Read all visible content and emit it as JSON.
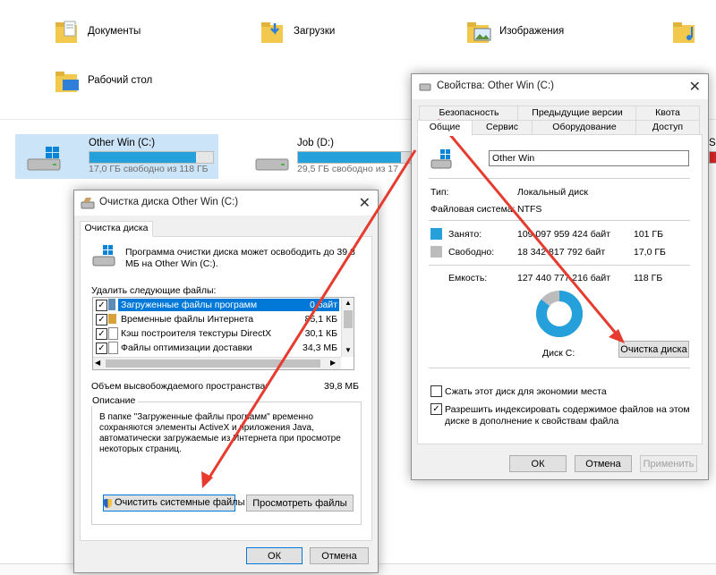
{
  "explorer": {
    "folders": [
      {
        "label": "Документы"
      },
      {
        "label": "Загрузки"
      },
      {
        "label": "Изображения"
      },
      {
        "label": "Рабочий стол"
      }
    ],
    "drives": [
      {
        "name": "Other Win (C:)",
        "free_text": "17,0 ГБ свободно из 118 ГБ",
        "used_fraction": 0.86
      },
      {
        "name": "Job (D:)",
        "free_text": "29,5 ГБ свободно из 17",
        "used_fraction": 0.9
      },
      {
        "name": "SS",
        "used_fraction": 0.95
      }
    ]
  },
  "cleanup_dialog": {
    "title": "Очистка диска Other Win (C:)",
    "close_glyph": "✕",
    "tab_label": "Очистка диска",
    "intro": [
      "Программа очистки диска может освободить до 39,8",
      "МБ на Other Win (C:)."
    ],
    "delete_label": "Удалить следующие файлы:",
    "files": [
      {
        "name": "Загруженные файлы программ",
        "size": "0 байт",
        "checked": true
      },
      {
        "name": "Временные файлы Интернета",
        "size": "85,1 КБ",
        "checked": true
      },
      {
        "name": "Кэш построителя текстуры DirectX",
        "size": "30,1 КБ",
        "checked": true
      },
      {
        "name": "Файлы оптимизации доставки",
        "size": "34,3 МБ",
        "checked": true
      }
    ],
    "space_label": "Объем высвобождаемого пространства:",
    "space_value": "39,8 МБ",
    "description_label": "Описание",
    "description": [
      "В папке \"Загруженные файлы программ\" временно",
      "сохраняются элементы ActiveX и приложения Java,",
      "автоматически загружаемые из Интернета при просмотре",
      "некоторых страниц."
    ],
    "clean_system_button": "Очистить системные файлы",
    "view_files_button": "Просмотреть файлы",
    "ok_button": "ОК",
    "cancel_button": "Отмена"
  },
  "properties_dialog": {
    "title": "Свойства: Other Win (C:)",
    "close_glyph": "✕",
    "tabs_top": [
      "Безопасность",
      "Предыдущие версии",
      "Квота"
    ],
    "tabs_bottom": [
      "Общие",
      "Сервис",
      "Оборудование",
      "Доступ"
    ],
    "drive_name_value": "Other Win",
    "type_label": "Тип:",
    "type_value": "Локальный диск",
    "fs_label": "Файловая система:",
    "fs_value": "NTFS",
    "used_label": "Занято:",
    "used_bytes": "109 097 959 424 байт",
    "used_size": "101 ГБ",
    "free_label": "Свободно:",
    "free_bytes": "18 342 817 792 байт",
    "free_size": "17,0 ГБ",
    "capacity_label": "Емкость:",
    "capacity_bytes": "127 440 777 216 байт",
    "capacity_size": "118 ГБ",
    "used_fraction": 0.856,
    "disk_label": "Диск C:",
    "cleanup_button": "Очистка диска",
    "compress_label": "Сжать этот диск для экономии места",
    "compress_checked": false,
    "index_label": [
      "Разрешить индексировать содержимое файлов на этом",
      "диске в дополнение к свойствам файла"
    ],
    "index_checked": true,
    "ok_button": "ОК",
    "cancel_button": "Отмена",
    "apply_button": "Применить"
  },
  "colors": {
    "used": "#26a0da",
    "free": "#bcbcbc",
    "arrow": "#e63b2e",
    "selection": "#cce4f7",
    "list_highlight": "#0078d7"
  }
}
